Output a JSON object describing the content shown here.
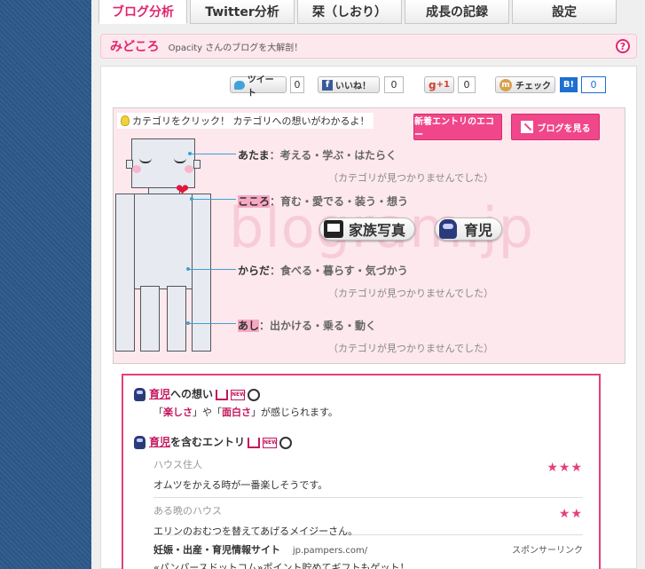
{
  "tabs": [
    {
      "label": "ブログ分析",
      "active": true
    },
    {
      "label": "Twitter分析",
      "active": false
    },
    {
      "label": "栞（しおり）",
      "active": false
    },
    {
      "label": "成長の記録",
      "active": false
    },
    {
      "label": "設定",
      "active": false
    }
  ],
  "midokoro": {
    "title": "みどころ",
    "subtitle": "Opacity さんのブログを大解剖！",
    "help": "?"
  },
  "social": {
    "tweet_label": "ツイート",
    "tweet_count": "0",
    "like_label": "いいね！",
    "like_count": "0",
    "gplus_label": "+1",
    "gplus_count": "0",
    "mixi_label": "チェック",
    "hatena_label": "B!",
    "hatena_count": "0"
  },
  "map": {
    "hint": "カテゴリをクリック！ カテゴリへの想いがわかるよ！",
    "echo_button": "新着エントリのエコー",
    "view_blog_button": "ブログを見る",
    "watermark": "blogram.jp",
    "categories": [
      {
        "head": "あたま",
        "items": "：考える・学ぶ・はたらく",
        "empty": "（カテゴリが見つかりませんでした）"
      },
      {
        "head": "こころ",
        "items": "：育む・愛でる・装う・想う",
        "empty": ""
      },
      {
        "head": "からだ",
        "items": "：食べる・暮らす・気づかう",
        "empty": "（カテゴリが見つかりませんでした）"
      },
      {
        "head": "あし",
        "items": "：出かける・乗る・動く",
        "empty": "（カテゴリが見つかりませんでした）"
      }
    ],
    "tags": [
      {
        "label": "家族写真",
        "icon": "photo-frame-icon"
      },
      {
        "label": "育児",
        "icon": "baby-icon"
      }
    ]
  },
  "detail": {
    "feeling_link": "育児",
    "feeling_suffix": "への想い",
    "feeling_text": [
      "「",
      "楽しさ",
      "」や「",
      "面白さ",
      "」が感じられます。"
    ],
    "entries_link": "育児",
    "entries_suffix": "を含むエントリ",
    "entries": [
      {
        "source": "ハウス住人",
        "text": "オムツをかえる時が一番楽しそうです。",
        "stars": "★★★"
      },
      {
        "source": "ある晩のハウス",
        "text": "エリンのおむつを替えてあげるメイジーさん。",
        "stars": "★★"
      }
    ],
    "sponsor": {
      "title": "妊娠・出産・育児情報サイト",
      "url": "jp.pampers.com/",
      "label": "スポンサーリンク",
      "text": "«パンパースドットコム»ポイント貯めてギフトもゲット！"
    }
  }
}
